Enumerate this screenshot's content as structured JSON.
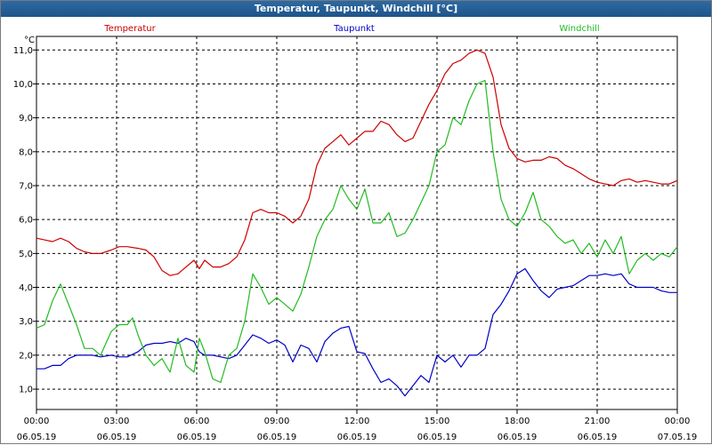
{
  "window": {
    "title": "Temperatur, Taupunkt, Windchill [°C]"
  },
  "chart_data": {
    "type": "line",
    "title": "Temperatur, Taupunkt, Windchill [°C]",
    "unit_label": "°C",
    "ylim": [
      0.4,
      11.4
    ],
    "yticks": [
      "1,0",
      "2,0",
      "3,0",
      "4,0",
      "5,0",
      "6,0",
      "7,0",
      "8,0",
      "9,0",
      "10,0",
      "11,0"
    ],
    "xlim_hours": [
      0,
      24
    ],
    "xticks": [
      {
        "time": "00:00",
        "date": "06.05.19"
      },
      {
        "time": "03:00",
        "date": "06.05.19"
      },
      {
        "time": "06:00",
        "date": "06.05.19"
      },
      {
        "time": "09:00",
        "date": "06.05.19"
      },
      {
        "time": "12:00",
        "date": "06.05.19"
      },
      {
        "time": "15:00",
        "date": "06.05.19"
      },
      {
        "time": "18:00",
        "date": "06.05.19"
      },
      {
        "time": "21:00",
        "date": "06.05.19"
      },
      {
        "time": "00:00",
        "date": "07.05.19"
      }
    ],
    "grid": true,
    "legend_position": "top",
    "series": [
      {
        "name": "Temperatur",
        "color": "#cc0000",
        "points": [
          [
            0,
            5.45
          ],
          [
            0.3,
            5.4
          ],
          [
            0.6,
            5.35
          ],
          [
            0.9,
            5.45
          ],
          [
            1.2,
            5.35
          ],
          [
            1.5,
            5.15
          ],
          [
            1.8,
            5.05
          ],
          [
            2.1,
            5.0
          ],
          [
            2.4,
            5.0
          ],
          [
            2.8,
            5.1
          ],
          [
            3.1,
            5.2
          ],
          [
            3.4,
            5.2
          ],
          [
            3.8,
            5.15
          ],
          [
            4.1,
            5.1
          ],
          [
            4.4,
            4.9
          ],
          [
            4.7,
            4.5
          ],
          [
            5.0,
            4.35
          ],
          [
            5.3,
            4.4
          ],
          [
            5.6,
            4.6
          ],
          [
            5.9,
            4.8
          ],
          [
            6.1,
            4.55
          ],
          [
            6.3,
            4.8
          ],
          [
            6.6,
            4.6
          ],
          [
            6.9,
            4.6
          ],
          [
            7.2,
            4.7
          ],
          [
            7.5,
            4.9
          ],
          [
            7.8,
            5.4
          ],
          [
            8.1,
            6.2
          ],
          [
            8.4,
            6.3
          ],
          [
            8.7,
            6.2
          ],
          [
            9.0,
            6.2
          ],
          [
            9.3,
            6.1
          ],
          [
            9.6,
            5.9
          ],
          [
            9.9,
            6.1
          ],
          [
            10.2,
            6.6
          ],
          [
            10.5,
            7.6
          ],
          [
            10.8,
            8.1
          ],
          [
            11.1,
            8.3
          ],
          [
            11.4,
            8.5
          ],
          [
            11.7,
            8.2
          ],
          [
            12.0,
            8.4
          ],
          [
            12.3,
            8.6
          ],
          [
            12.6,
            8.6
          ],
          [
            12.9,
            8.9
          ],
          [
            13.2,
            8.8
          ],
          [
            13.5,
            8.5
          ],
          [
            13.8,
            8.3
          ],
          [
            14.1,
            8.4
          ],
          [
            14.4,
            8.9
          ],
          [
            14.7,
            9.4
          ],
          [
            15.0,
            9.8
          ],
          [
            15.3,
            10.3
          ],
          [
            15.6,
            10.6
          ],
          [
            15.9,
            10.7
          ],
          [
            16.2,
            10.9
          ],
          [
            16.5,
            11.0
          ],
          [
            16.8,
            10.9
          ],
          [
            17.1,
            10.2
          ],
          [
            17.4,
            8.8
          ],
          [
            17.7,
            8.1
          ],
          [
            18.0,
            7.8
          ],
          [
            18.3,
            7.7
          ],
          [
            18.6,
            7.75
          ],
          [
            18.9,
            7.75
          ],
          [
            19.2,
            7.85
          ],
          [
            19.5,
            7.8
          ],
          [
            19.8,
            7.6
          ],
          [
            20.1,
            7.5
          ],
          [
            20.4,
            7.35
          ],
          [
            20.7,
            7.2
          ],
          [
            21.0,
            7.1
          ],
          [
            21.3,
            7.05
          ],
          [
            21.6,
            7.0
          ],
          [
            21.9,
            7.15
          ],
          [
            22.2,
            7.2
          ],
          [
            22.5,
            7.1
          ],
          [
            22.8,
            7.15
          ],
          [
            23.1,
            7.1
          ],
          [
            23.4,
            7.05
          ],
          [
            23.7,
            7.05
          ],
          [
            24.0,
            7.15
          ]
        ]
      },
      {
        "name": "Taupunkt",
        "color": "#0000c8",
        "points": [
          [
            0,
            1.6
          ],
          [
            0.3,
            1.6
          ],
          [
            0.6,
            1.7
          ],
          [
            0.9,
            1.7
          ],
          [
            1.2,
            1.9
          ],
          [
            1.5,
            2.0
          ],
          [
            1.8,
            2.0
          ],
          [
            2.1,
            2.0
          ],
          [
            2.4,
            1.95
          ],
          [
            2.8,
            2.0
          ],
          [
            3.1,
            1.95
          ],
          [
            3.4,
            1.95
          ],
          [
            3.8,
            2.1
          ],
          [
            4.1,
            2.3
          ],
          [
            4.4,
            2.35
          ],
          [
            4.7,
            2.35
          ],
          [
            5.0,
            2.4
          ],
          [
            5.3,
            2.35
          ],
          [
            5.6,
            2.5
          ],
          [
            5.9,
            2.4
          ],
          [
            6.1,
            2.1
          ],
          [
            6.3,
            2.0
          ],
          [
            6.6,
            2.0
          ],
          [
            6.9,
            1.95
          ],
          [
            7.2,
            1.9
          ],
          [
            7.5,
            2.0
          ],
          [
            7.8,
            2.3
          ],
          [
            8.1,
            2.6
          ],
          [
            8.4,
            2.5
          ],
          [
            8.7,
            2.35
          ],
          [
            9.0,
            2.45
          ],
          [
            9.3,
            2.3
          ],
          [
            9.6,
            1.8
          ],
          [
            9.9,
            2.3
          ],
          [
            10.2,
            2.2
          ],
          [
            10.5,
            1.8
          ],
          [
            10.8,
            2.4
          ],
          [
            11.1,
            2.65
          ],
          [
            11.4,
            2.8
          ],
          [
            11.7,
            2.85
          ],
          [
            12.0,
            2.1
          ],
          [
            12.3,
            2.05
          ],
          [
            12.6,
            1.6
          ],
          [
            12.9,
            1.2
          ],
          [
            13.2,
            1.3
          ],
          [
            13.5,
            1.1
          ],
          [
            13.8,
            0.8
          ],
          [
            14.1,
            1.1
          ],
          [
            14.4,
            1.4
          ],
          [
            14.7,
            1.2
          ],
          [
            15.0,
            2.0
          ],
          [
            15.3,
            1.8
          ],
          [
            15.6,
            2.0
          ],
          [
            15.9,
            1.65
          ],
          [
            16.2,
            2.0
          ],
          [
            16.5,
            2.0
          ],
          [
            16.8,
            2.2
          ],
          [
            17.1,
            3.2
          ],
          [
            17.4,
            3.5
          ],
          [
            17.7,
            3.9
          ],
          [
            18.0,
            4.4
          ],
          [
            18.3,
            4.55
          ],
          [
            18.6,
            4.2
          ],
          [
            18.9,
            3.9
          ],
          [
            19.2,
            3.7
          ],
          [
            19.5,
            3.95
          ],
          [
            19.8,
            4.0
          ],
          [
            20.1,
            4.05
          ],
          [
            20.4,
            4.2
          ],
          [
            20.7,
            4.35
          ],
          [
            21.0,
            4.35
          ],
          [
            21.3,
            4.4
          ],
          [
            21.6,
            4.35
          ],
          [
            21.9,
            4.4
          ],
          [
            22.2,
            4.1
          ],
          [
            22.5,
            4.0
          ],
          [
            22.8,
            4.0
          ],
          [
            23.1,
            4.0
          ],
          [
            23.4,
            3.9
          ],
          [
            23.7,
            3.85
          ],
          [
            24.0,
            3.85
          ]
        ]
      },
      {
        "name": "Windchill",
        "color": "#22bb22",
        "points": [
          [
            0,
            2.8
          ],
          [
            0.3,
            2.9
          ],
          [
            0.6,
            3.6
          ],
          [
            0.9,
            4.1
          ],
          [
            1.2,
            3.5
          ],
          [
            1.5,
            2.9
          ],
          [
            1.8,
            2.2
          ],
          [
            2.1,
            2.2
          ],
          [
            2.4,
            2.0
          ],
          [
            2.8,
            2.7
          ],
          [
            3.1,
            2.9
          ],
          [
            3.4,
            2.9
          ],
          [
            3.6,
            3.1
          ],
          [
            3.8,
            2.6
          ],
          [
            4.1,
            2.0
          ],
          [
            4.4,
            1.7
          ],
          [
            4.7,
            1.9
          ],
          [
            5.0,
            1.5
          ],
          [
            5.3,
            2.5
          ],
          [
            5.6,
            1.7
          ],
          [
            5.9,
            1.5
          ],
          [
            6.1,
            2.5
          ],
          [
            6.3,
            2.1
          ],
          [
            6.6,
            1.3
          ],
          [
            6.9,
            1.2
          ],
          [
            7.2,
            2.0
          ],
          [
            7.5,
            2.2
          ],
          [
            7.8,
            3.0
          ],
          [
            8.1,
            4.4
          ],
          [
            8.4,
            4.0
          ],
          [
            8.7,
            3.5
          ],
          [
            9.0,
            3.7
          ],
          [
            9.3,
            3.5
          ],
          [
            9.6,
            3.3
          ],
          [
            9.9,
            3.8
          ],
          [
            10.2,
            4.6
          ],
          [
            10.5,
            5.5
          ],
          [
            10.8,
            6.0
          ],
          [
            11.1,
            6.3
          ],
          [
            11.4,
            7.0
          ],
          [
            11.7,
            6.6
          ],
          [
            12.0,
            6.3
          ],
          [
            12.3,
            6.9
          ],
          [
            12.6,
            5.9
          ],
          [
            12.9,
            5.9
          ],
          [
            13.2,
            6.2
          ],
          [
            13.5,
            5.5
          ],
          [
            13.8,
            5.6
          ],
          [
            14.1,
            6.0
          ],
          [
            14.4,
            6.5
          ],
          [
            14.7,
            7.0
          ],
          [
            15.0,
            8.0
          ],
          [
            15.3,
            8.2
          ],
          [
            15.6,
            9.0
          ],
          [
            15.9,
            8.8
          ],
          [
            16.2,
            9.5
          ],
          [
            16.5,
            10.0
          ],
          [
            16.8,
            10.1
          ],
          [
            17.1,
            8.0
          ],
          [
            17.4,
            6.6
          ],
          [
            17.7,
            6.0
          ],
          [
            18.0,
            5.8
          ],
          [
            18.3,
            6.2
          ],
          [
            18.6,
            6.8
          ],
          [
            18.9,
            6.0
          ],
          [
            19.2,
            5.8
          ],
          [
            19.5,
            5.5
          ],
          [
            19.8,
            5.3
          ],
          [
            20.1,
            5.4
          ],
          [
            20.4,
            5.0
          ],
          [
            20.7,
            5.3
          ],
          [
            21.0,
            4.9
          ],
          [
            21.3,
            5.4
          ],
          [
            21.6,
            5.0
          ],
          [
            21.9,
            5.5
          ],
          [
            22.2,
            4.4
          ],
          [
            22.5,
            4.8
          ],
          [
            22.8,
            5.0
          ],
          [
            23.1,
            4.8
          ],
          [
            23.4,
            5.0
          ],
          [
            23.7,
            4.9
          ],
          [
            24.0,
            5.2
          ]
        ]
      }
    ]
  }
}
